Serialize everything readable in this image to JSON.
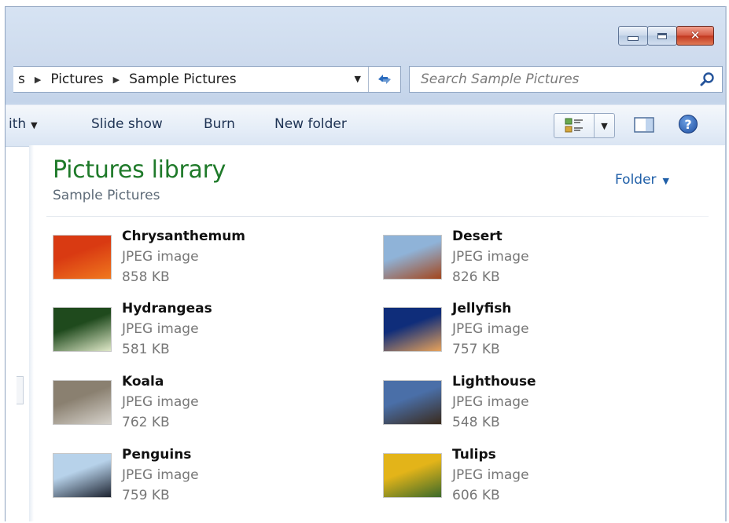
{
  "window": {
    "minimize": "minimize",
    "maximize": "maximize",
    "close": "close"
  },
  "address": {
    "crumbs": [
      "s",
      "Pictures",
      "Sample Pictures"
    ]
  },
  "search": {
    "placeholder": "Search Sample Pictures"
  },
  "toolbar": {
    "open_with": "ith",
    "slide_show": "Slide show",
    "burn": "Burn",
    "new_folder": "New folder"
  },
  "library": {
    "title": "Pictures library",
    "subtitle": "Sample Pictures",
    "arrange_by": "Folder"
  },
  "files": [
    {
      "name": "Chrysanthemum",
      "type": "JPEG image",
      "size": "858 KB",
      "thumb_colors": [
        "#d93a12",
        "#f0781e"
      ]
    },
    {
      "name": "Desert",
      "type": "JPEG image",
      "size": "826 KB",
      "thumb_colors": [
        "#8fb3d8",
        "#a3461c"
      ]
    },
    {
      "name": "Hydrangeas",
      "type": "JPEG image",
      "size": "581 KB",
      "thumb_colors": [
        "#1f4a1d",
        "#dfe8c8"
      ]
    },
    {
      "name": "Jellyfish",
      "type": "JPEG image",
      "size": "757 KB",
      "thumb_colors": [
        "#0f2d7a",
        "#e7a25a"
      ]
    },
    {
      "name": "Koala",
      "type": "JPEG image",
      "size": "762 KB",
      "thumb_colors": [
        "#8a8070",
        "#d6d2cb"
      ]
    },
    {
      "name": "Lighthouse",
      "type": "JPEG image",
      "size": "548 KB",
      "thumb_colors": [
        "#4a6fa8",
        "#3a2a1c"
      ]
    },
    {
      "name": "Penguins",
      "type": "JPEG image",
      "size": "759 KB",
      "thumb_colors": [
        "#b7d2ea",
        "#1d2330"
      ]
    },
    {
      "name": "Tulips",
      "type": "JPEG image",
      "size": "606 KB",
      "thumb_colors": [
        "#e3b419",
        "#3c6a2a"
      ]
    }
  ]
}
